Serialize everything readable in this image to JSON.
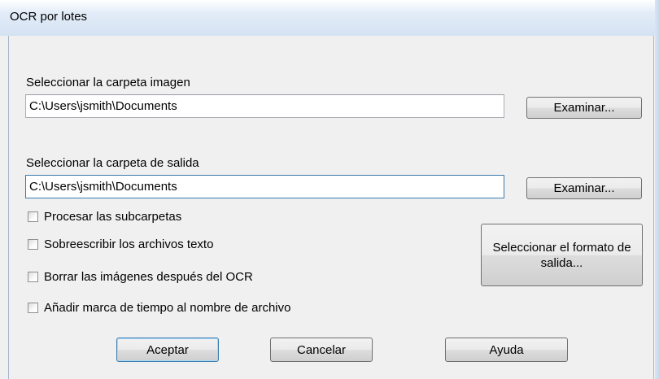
{
  "window": {
    "title": "OCR por lotes"
  },
  "image_folder": {
    "label": "Seleccionar la carpeta imagen",
    "value": "C:\\Users\\jsmith\\Documents",
    "browse_label": "Examinar..."
  },
  "output_folder": {
    "label": "Seleccionar la carpeta de salida",
    "value": "C:\\Users\\jsmith\\Documents",
    "browse_label": "Examinar..."
  },
  "options": [
    {
      "label": "Procesar las subcarpetas",
      "checked": false
    },
    {
      "label": "Sobreescribir los archivos texto",
      "checked": false
    },
    {
      "label": "Borrar las imágenes después del OCR",
      "checked": false
    },
    {
      "label": "Añadir marca de tiempo al nombre de archivo",
      "checked": false
    }
  ],
  "format_button": {
    "label": "Seleccionar el formato de salida..."
  },
  "buttons": {
    "ok": "Aceptar",
    "cancel": "Cancelar",
    "help": "Ayuda"
  },
  "colors": {
    "title_gradient_top": "#ffffff",
    "title_gradient_bottom": "#d4e2f2",
    "dialog_bg": "#f0f0f0",
    "default_button_border": "#3c7fb1"
  }
}
